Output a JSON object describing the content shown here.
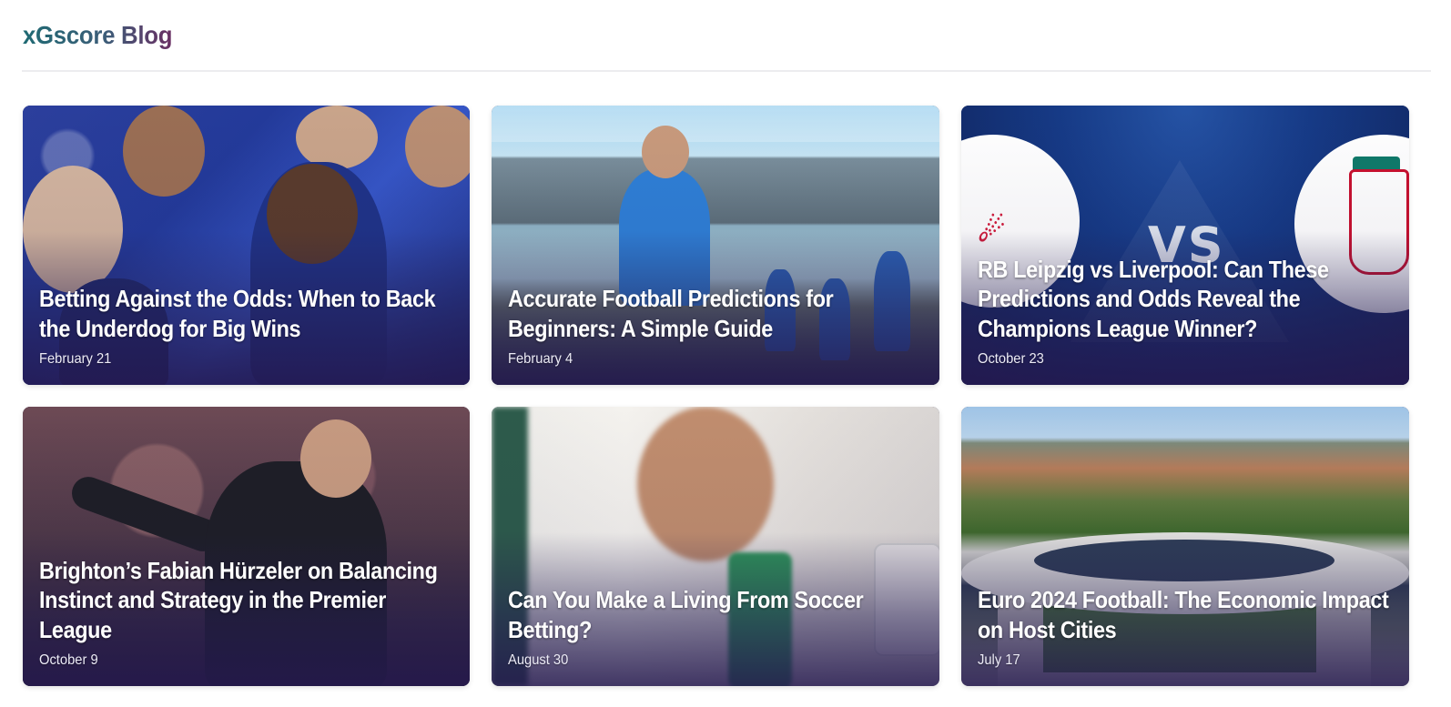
{
  "header": {
    "title": "xGscore Blog"
  },
  "theme": {
    "brand_gradient_start": "#1f6a73",
    "brand_gradient_end": "#6a2f63",
    "card_overlay": "#241850"
  },
  "posts": [
    {
      "title": "Betting Against the Odds: When to Back the Underdog for Big Wins",
      "date": "February 21"
    },
    {
      "title": "Accurate Football Predictions for Beginners: A Simple Guide",
      "date": "February 4"
    },
    {
      "title": "RB Leipzig vs Liverpool: Can These Predictions and Odds Reveal the Champions League Winner?",
      "date": "October 23",
      "image_text": "VS"
    },
    {
      "title": "Brighton’s Fabian Hürzeler on Balancing Instinct and Strategy in the Premier League",
      "date": "October 9"
    },
    {
      "title": "Can You Make a Living From Soccer Betting?",
      "date": "August 30"
    },
    {
      "title": "Euro 2024 Football: The Economic Impact on Host Cities",
      "date": "July 17"
    }
  ]
}
